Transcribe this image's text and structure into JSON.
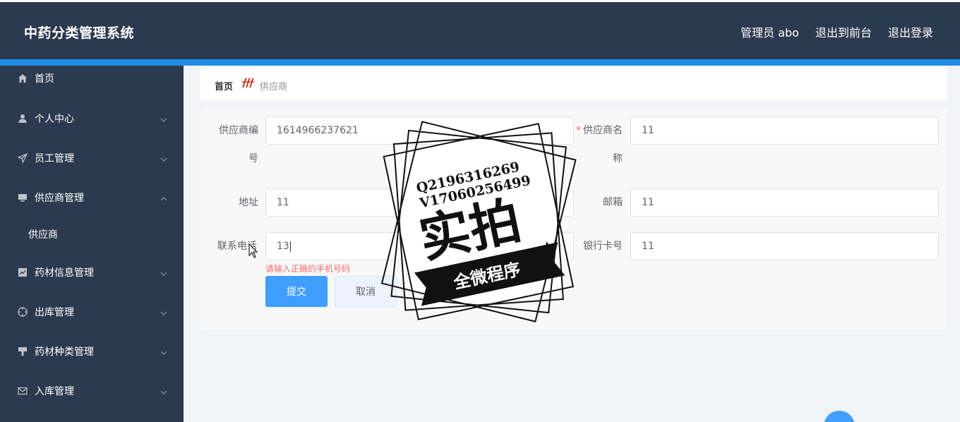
{
  "header": {
    "app_title": "中药分类管理系统",
    "user_label": "管理员 abo",
    "back_frontend": "退出到前台",
    "logout": "退出登录"
  },
  "sidebar": {
    "items": [
      {
        "label": "首页",
        "icon": "home-icon"
      },
      {
        "label": "个人中心",
        "icon": "user-icon"
      },
      {
        "label": "员工管理",
        "icon": "send-icon"
      },
      {
        "label": "供应商管理",
        "icon": "monitor-icon"
      },
      {
        "label": "供应商",
        "icon": ""
      },
      {
        "label": "药材信息管理",
        "icon": "chart-icon"
      },
      {
        "label": "出库管理",
        "icon": "target-icon"
      },
      {
        "label": "药材种类管理",
        "icon": "brush-icon"
      },
      {
        "label": "入库管理",
        "icon": "mail-icon"
      }
    ]
  },
  "breadcrumb": {
    "home": "首页",
    "current": "供应商"
  },
  "form": {
    "supplier_no": {
      "label_line1": "供应商编",
      "label_line2": "号",
      "value": "1614966237621"
    },
    "supplier_name": {
      "required": "*",
      "label_line1": "供应商名",
      "label_line2": "称",
      "value": "11"
    },
    "address": {
      "label": "地址",
      "value": "11"
    },
    "email": {
      "label": "邮箱",
      "value": "11"
    },
    "phone": {
      "label": "联系电话",
      "value": "13",
      "error": "请输入正确的手机号码"
    },
    "bank_card": {
      "label": "银行卡号",
      "value": "11"
    },
    "submit_label": "提交",
    "cancel_label": "取消"
  },
  "stamp": {
    "qq": "Q2196316269",
    "vx": "V17060256499",
    "main": "实拍",
    "banner": "全微程序"
  },
  "colors": {
    "header_bg": "#2b3a4e",
    "accent_strip": "#1f8fe6",
    "primary": "#409eff",
    "error": "#f56c6c"
  }
}
